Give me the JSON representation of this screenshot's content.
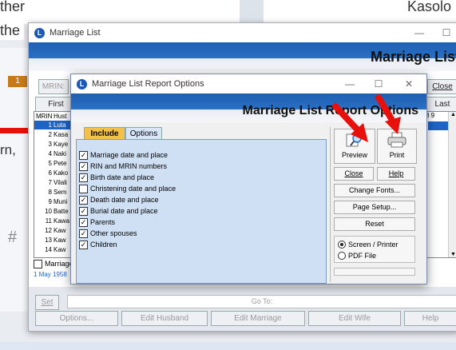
{
  "background": {
    "text_top_left_1": "ther",
    "text_top_left_2": "the",
    "text_top_right": "Kasolo",
    "text_mid_left": "rn,",
    "text_hash": "#",
    "badge_left": "1"
  },
  "main_window": {
    "title": "Marriage List",
    "banner_title": "Marriage List",
    "mrin_label": "MRIN:",
    "first_button": "First",
    "last_button": "Last",
    "close_button": "Close",
    "columns": [
      "MRIN",
      "Hust"
    ],
    "rows": [
      {
        "n": "1",
        "h": "Luta"
      },
      {
        "n": "2",
        "h": "Kasa"
      },
      {
        "n": "3",
        "h": "Kaye"
      },
      {
        "n": "4",
        "h": "Naki"
      },
      {
        "n": "5",
        "h": "Pete"
      },
      {
        "n": "6",
        "h": "Kako"
      },
      {
        "n": "7",
        "h": "Vilali"
      },
      {
        "n": "8",
        "h": "Sem"
      },
      {
        "n": "9",
        "h": "Muni"
      },
      {
        "n": "10",
        "h": "Batte"
      },
      {
        "n": "11",
        "h": "Kawa"
      },
      {
        "n": "12",
        "h": "Kaw"
      },
      {
        "n": "13",
        "h": "Kaw"
      },
      {
        "n": "14",
        "h": "Kaw"
      }
    ],
    "right_col_header": "8 9",
    "marriage_checkbox": "Marriage",
    "date_text": "1 May 1958",
    "set_button": "Set",
    "goto_label": "Go To:",
    "bottom_buttons": [
      "Options...",
      "Edit Husband",
      "Edit Marriage",
      "Edit Wife",
      "Help"
    ]
  },
  "dialog": {
    "title": "Marriage List Report Options",
    "banner_title": "Marriage List Report Options",
    "tabs": [
      "Include",
      "Options"
    ],
    "options": [
      {
        "label": "Marriage date and place",
        "checked": true
      },
      {
        "label": "RIN and MRIN numbers",
        "checked": true
      },
      {
        "label": "Birth date and place",
        "checked": true
      },
      {
        "label": "Christening date and place",
        "checked": false
      },
      {
        "label": "Death date and place",
        "checked": true
      },
      {
        "label": "Burial date and place",
        "checked": true
      },
      {
        "label": "Parents",
        "checked": true
      },
      {
        "label": "Other spouses",
        "checked": true
      },
      {
        "label": "Children",
        "checked": true
      }
    ],
    "preview_label": "Preview",
    "print_label": "Print",
    "close_button": "Close",
    "help_button": "Help",
    "change_fonts_button": "Change Fonts...",
    "page_setup_button": "Page Setup...",
    "reset_button": "Reset",
    "output_options": [
      {
        "label": "Screen / Printer",
        "selected": true
      },
      {
        "label": "PDF File",
        "selected": false
      }
    ]
  },
  "colors": {
    "accent": "#1e63c6",
    "arrow": "#e8100a",
    "pane": "#cfe0f5"
  }
}
